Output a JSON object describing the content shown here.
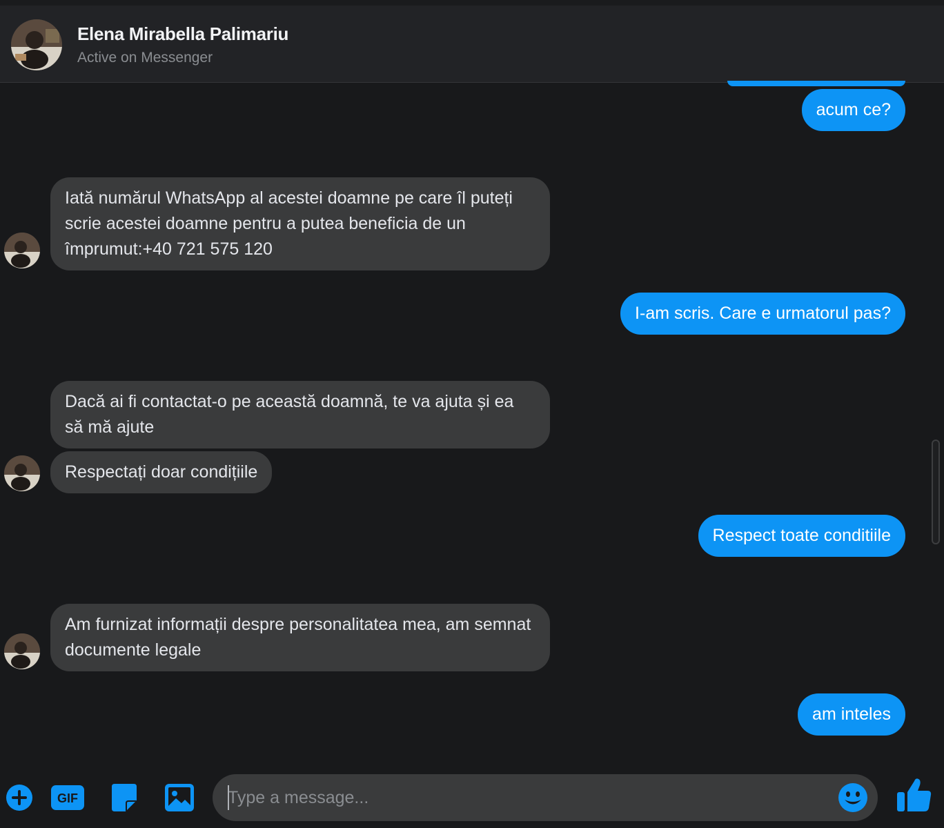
{
  "header": {
    "name": "Elena Mirabella Palimariu",
    "status": "Active on Messenger"
  },
  "messages": [
    {
      "direction": "outgoing",
      "text": "acum ce?"
    },
    {
      "direction": "incoming",
      "text": "Iată numărul WhatsApp al acestei doamne pe care îl puteți scrie acestei doamne pentru a putea beneficia de un împrumut:+40 721 575 120"
    },
    {
      "direction": "outgoing",
      "text": "I-am scris. Care e urmatorul pas?"
    },
    {
      "direction": "incoming",
      "text": "Dacă ai fi contactat-o pe această doamnă, te va ajuta și ea să mă ajute"
    },
    {
      "direction": "incoming",
      "text": "Respectați doar condițiile"
    },
    {
      "direction": "outgoing",
      "text": "Respect toate conditiile"
    },
    {
      "direction": "incoming",
      "text": "Am furnizat informații despre personalitatea mea, am semnat documente legale"
    },
    {
      "direction": "outgoing",
      "text": "am inteles"
    }
  ],
  "composer": {
    "placeholder": "Type a message...",
    "icons": [
      "plus-icon",
      "gif-icon",
      "sticker-icon",
      "image-icon",
      "emoji-icon",
      "like-icon"
    ],
    "gif_label": "GIF"
  },
  "colors": {
    "accent": "#0d94f5",
    "incoming_bubble": "#3a3b3c",
    "background": "#18191b",
    "header": "#222326"
  }
}
